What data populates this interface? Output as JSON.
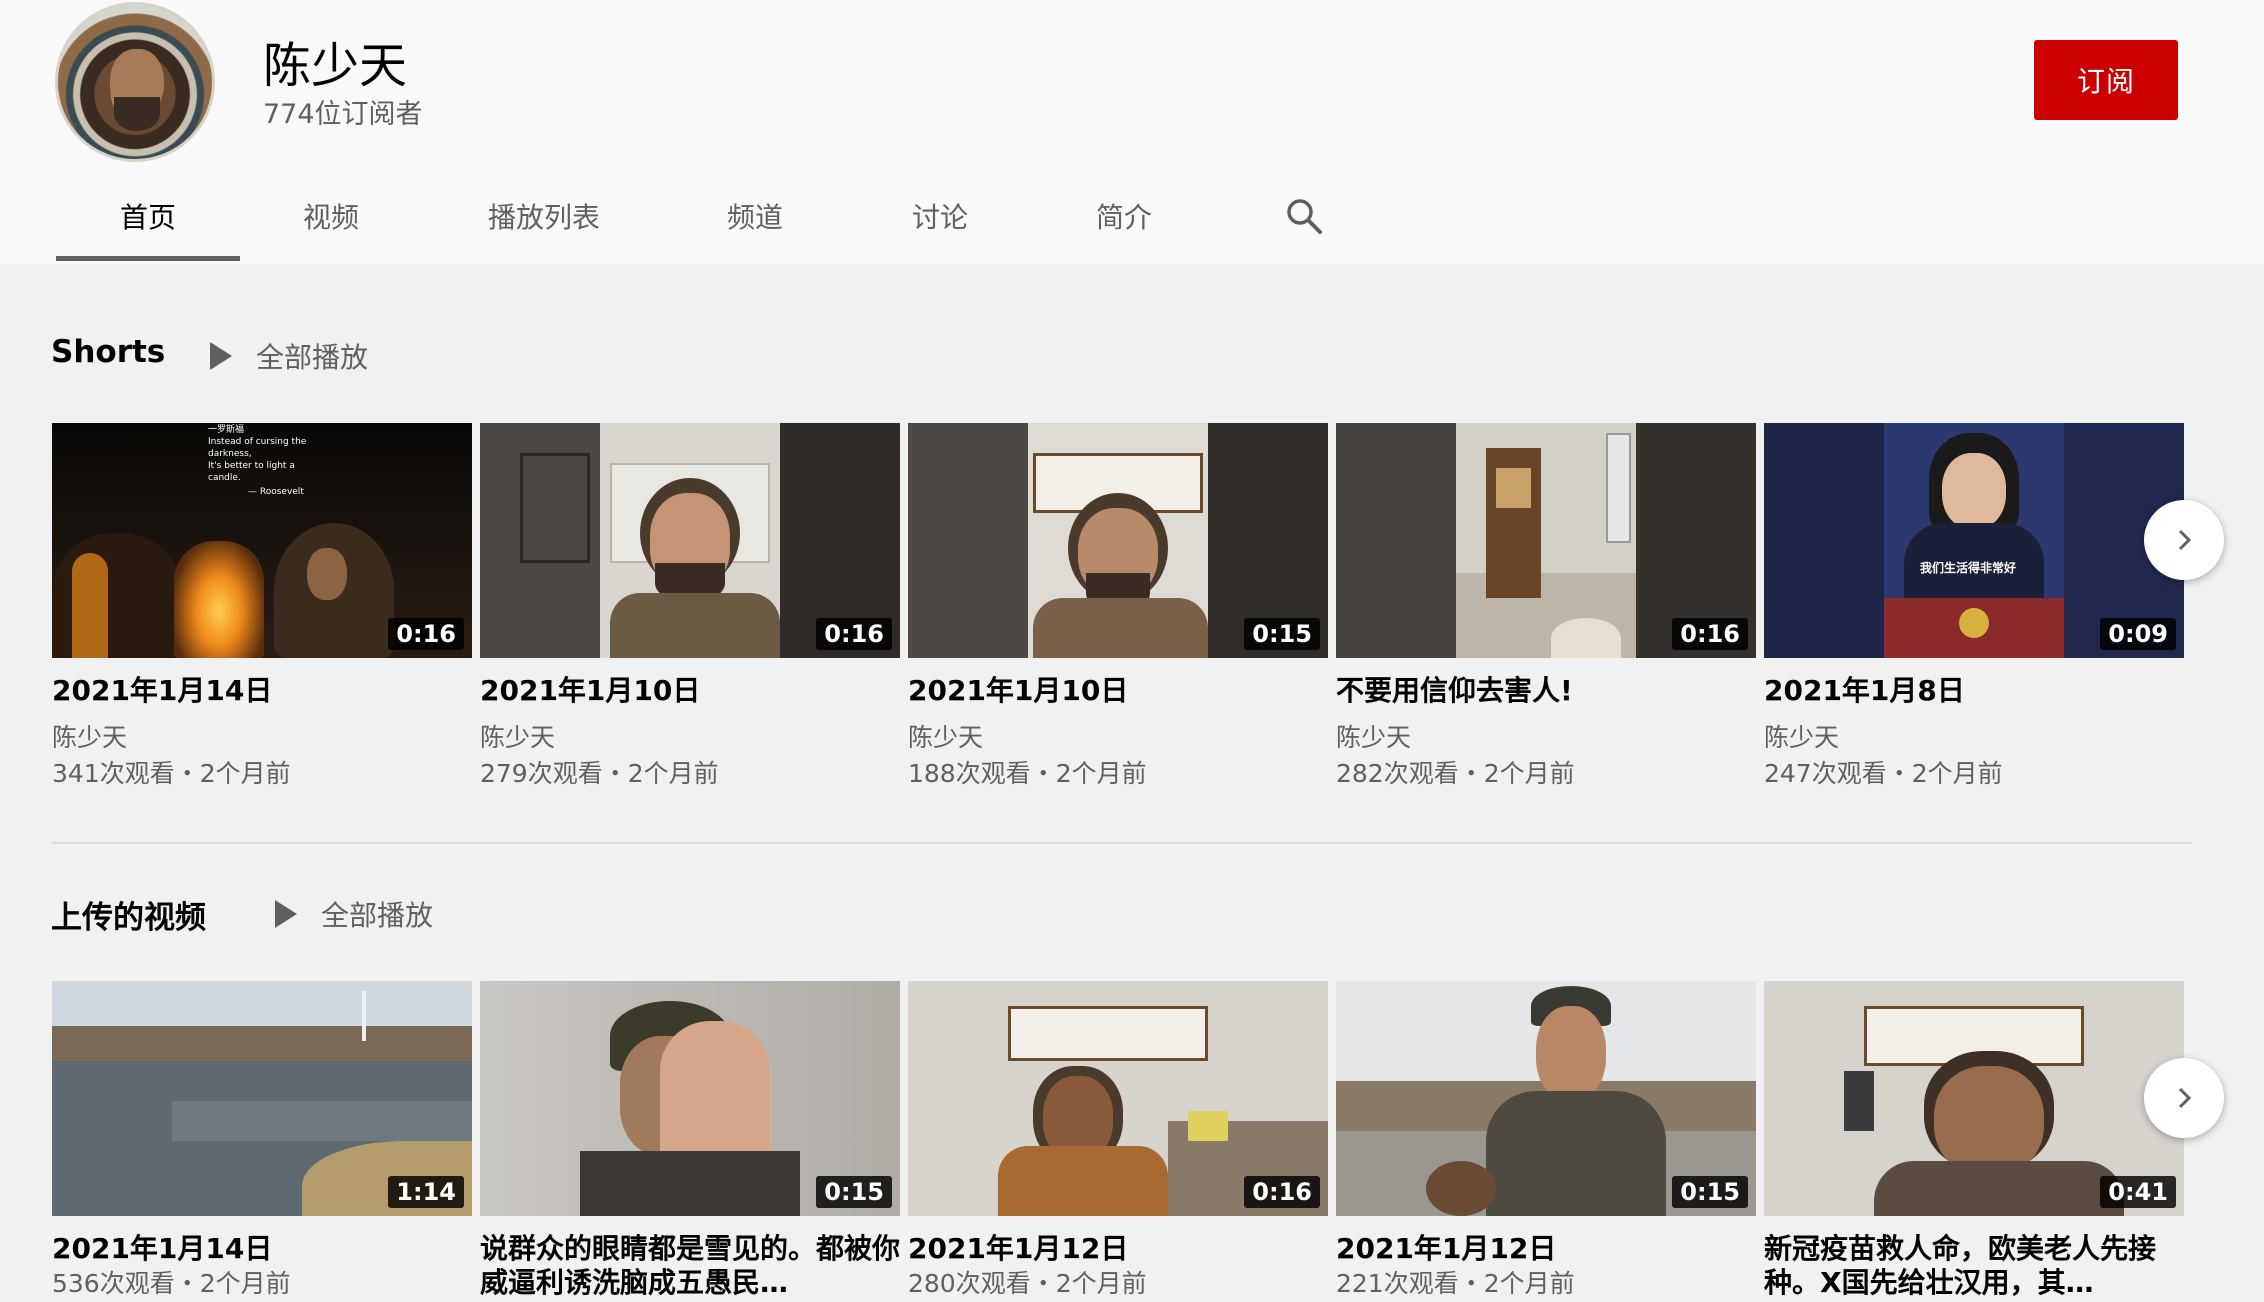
{
  "channel": {
    "name": "陈少天",
    "subscribers": "774位订阅者",
    "subscribe_label": "订阅"
  },
  "tabs": [
    {
      "label": "首页",
      "active": true
    },
    {
      "label": "视频",
      "active": false
    },
    {
      "label": "播放列表",
      "active": false
    },
    {
      "label": "频道",
      "active": false
    },
    {
      "label": "讨论",
      "active": false
    },
    {
      "label": "简介",
      "active": false
    }
  ],
  "shorts": {
    "title": "Shorts",
    "play_all": "全部播放",
    "items": [
      {
        "title": "2021年1月14日",
        "channel": "陈少天",
        "meta": "341次观看・2个月前",
        "duration": "0:16",
        "overlay": [
          "一罗斯福",
          "Instead of cursing the",
          "darkness,",
          "It's better to light a",
          "candle.",
          "— Roosevelt"
        ]
      },
      {
        "title": "2021年1月10日",
        "channel": "陈少天",
        "meta": "279次观看・2个月前",
        "duration": "0:16"
      },
      {
        "title": "2021年1月10日",
        "channel": "陈少天",
        "meta": "188次观看・2个月前",
        "duration": "0:15"
      },
      {
        "title": "不要用信仰去害人!",
        "channel": "陈少天",
        "meta": "282次观看・2个月前",
        "duration": "0:16"
      },
      {
        "title": "2021年1月8日",
        "channel": "陈少天",
        "meta": "247次观看・2个月前",
        "duration": "0:09",
        "overlay": [
          "我们生活得非常好"
        ]
      }
    ]
  },
  "uploads": {
    "title": "上传的视频",
    "play_all": "全部播放",
    "items": [
      {
        "title": "2021年1月14日",
        "meta": "536次观看・2个月前",
        "duration": "1:14"
      },
      {
        "title": "说群众的眼睛都是雪见的。都被你威逼利诱洗脑成五愚民…",
        "meta": "",
        "duration": "0:15"
      },
      {
        "title": "2021年1月12日",
        "meta": "280次观看・2个月前",
        "duration": "0:16"
      },
      {
        "title": "2021年1月12日",
        "meta": "221次观看・2个月前",
        "duration": "0:15"
      },
      {
        "title": "新冠疫苗救人命，欧美老人先接种。X国先给壮汉用，其…",
        "meta": "",
        "duration": "0:41"
      }
    ]
  },
  "icons": {
    "search": "search-icon",
    "play": "play-icon",
    "next": "chevron-right-icon"
  },
  "colors": {
    "subscribe": "#cc0000",
    "page_bg": "#f9f9f9",
    "content_bg": "#f1f1f1"
  }
}
